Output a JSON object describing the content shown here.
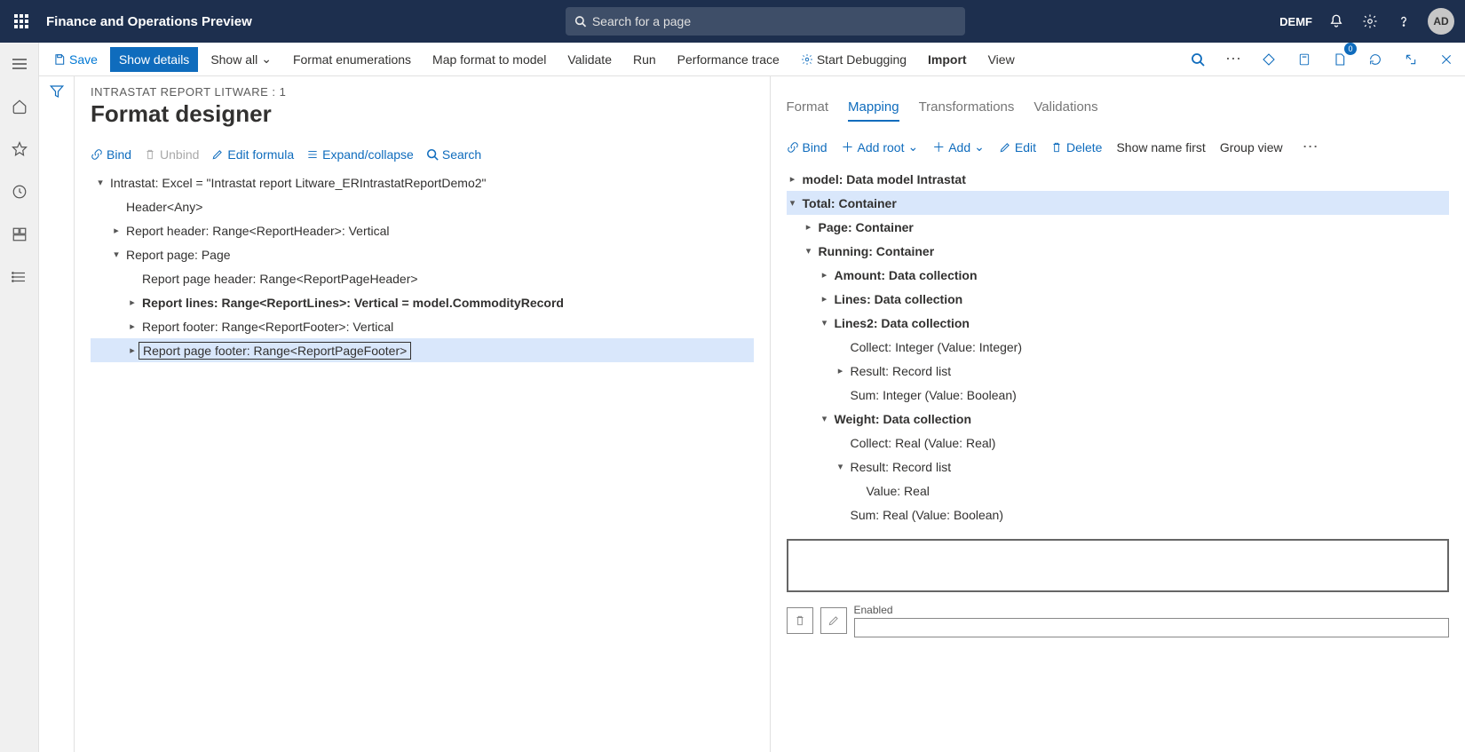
{
  "top": {
    "app_title": "Finance and Operations Preview",
    "search_placeholder": "Search for a page",
    "company": "DEMF",
    "avatar_text": "AD"
  },
  "cmd": {
    "save": "Save",
    "show_details": "Show details",
    "show_all": "Show all",
    "format_enum": "Format enumerations",
    "map_format": "Map format to model",
    "validate": "Validate",
    "run": "Run",
    "perf_trace": "Performance trace",
    "start_debug": "Start Debugging",
    "import": "Import",
    "view": "View",
    "badge_count": "0"
  },
  "page": {
    "breadcrumb": "INTRASTAT REPORT LITWARE : 1",
    "title": "Format designer"
  },
  "left_actions": {
    "bind": "Bind",
    "unbind": "Unbind",
    "edit_formula": "Edit formula",
    "expand_collapse": "Expand/collapse",
    "search": "Search"
  },
  "format_tree": [
    {
      "indent": 0,
      "chev": "▾",
      "label": "Intrastat: Excel = \"Intrastat report Litware_ERIntrastatReportDemo2\"",
      "bold": false
    },
    {
      "indent": 1,
      "chev": "",
      "label": "Header<Any>",
      "bold": false
    },
    {
      "indent": 1,
      "chev": "▸",
      "label": "Report header: Range<ReportHeader>: Vertical",
      "bold": false
    },
    {
      "indent": 1,
      "chev": "▾",
      "label": "Report page: Page",
      "bold": false
    },
    {
      "indent": 2,
      "chev": "",
      "label": "Report page header: Range<ReportPageHeader>",
      "bold": false
    },
    {
      "indent": 2,
      "chev": "▸",
      "label": "Report lines: Range<ReportLines>: Vertical = model.CommodityRecord",
      "bold": true
    },
    {
      "indent": 2,
      "chev": "▸",
      "label": "Report footer: Range<ReportFooter>: Vertical",
      "bold": false
    },
    {
      "indent": 2,
      "chev": "▸",
      "label": "Report page footer: Range<ReportPageFooter>",
      "bold": false,
      "selected": true,
      "boxed": true
    }
  ],
  "tabs": {
    "format": "Format",
    "mapping": "Mapping",
    "transformations": "Transformations",
    "validations": "Validations"
  },
  "right_actions": {
    "bind": "Bind",
    "add_root": "Add root",
    "add": "Add",
    "edit": "Edit",
    "delete": "Delete",
    "show_name_first": "Show name first",
    "group_view": "Group view"
  },
  "ds_tree": [
    {
      "indent": 0,
      "chev": "▸",
      "label": "model: Data model Intrastat",
      "bold": true
    },
    {
      "indent": 0,
      "chev": "▾",
      "label": "Total: Container",
      "bold": true,
      "selected": true
    },
    {
      "indent": 1,
      "chev": "▸",
      "label": "Page: Container",
      "bold": true
    },
    {
      "indent": 1,
      "chev": "▾",
      "label": "Running: Container",
      "bold": true
    },
    {
      "indent": 2,
      "chev": "▸",
      "label": "Amount: Data collection",
      "bold": true
    },
    {
      "indent": 2,
      "chev": "▸",
      "label": "Lines: Data collection",
      "bold": true
    },
    {
      "indent": 2,
      "chev": "▾",
      "label": "Lines2: Data collection",
      "bold": true
    },
    {
      "indent": 3,
      "chev": "",
      "label": "Collect: Integer (Value: Integer)",
      "bold": false
    },
    {
      "indent": 3,
      "chev": "▸",
      "label": "Result: Record list",
      "bold": false
    },
    {
      "indent": 3,
      "chev": "",
      "label": "Sum: Integer (Value: Boolean)",
      "bold": false
    },
    {
      "indent": 2,
      "chev": "▾",
      "label": "Weight: Data collection",
      "bold": true
    },
    {
      "indent": 3,
      "chev": "",
      "label": "Collect: Real (Value: Real)",
      "bold": false
    },
    {
      "indent": 3,
      "chev": "▾",
      "label": "Result: Record list",
      "bold": false
    },
    {
      "indent": 4,
      "chev": "",
      "label": "Value: Real",
      "bold": false
    },
    {
      "indent": 3,
      "chev": "",
      "label": "Sum: Real (Value: Boolean)",
      "bold": false
    }
  ],
  "prop": {
    "enabled_label": "Enabled"
  }
}
